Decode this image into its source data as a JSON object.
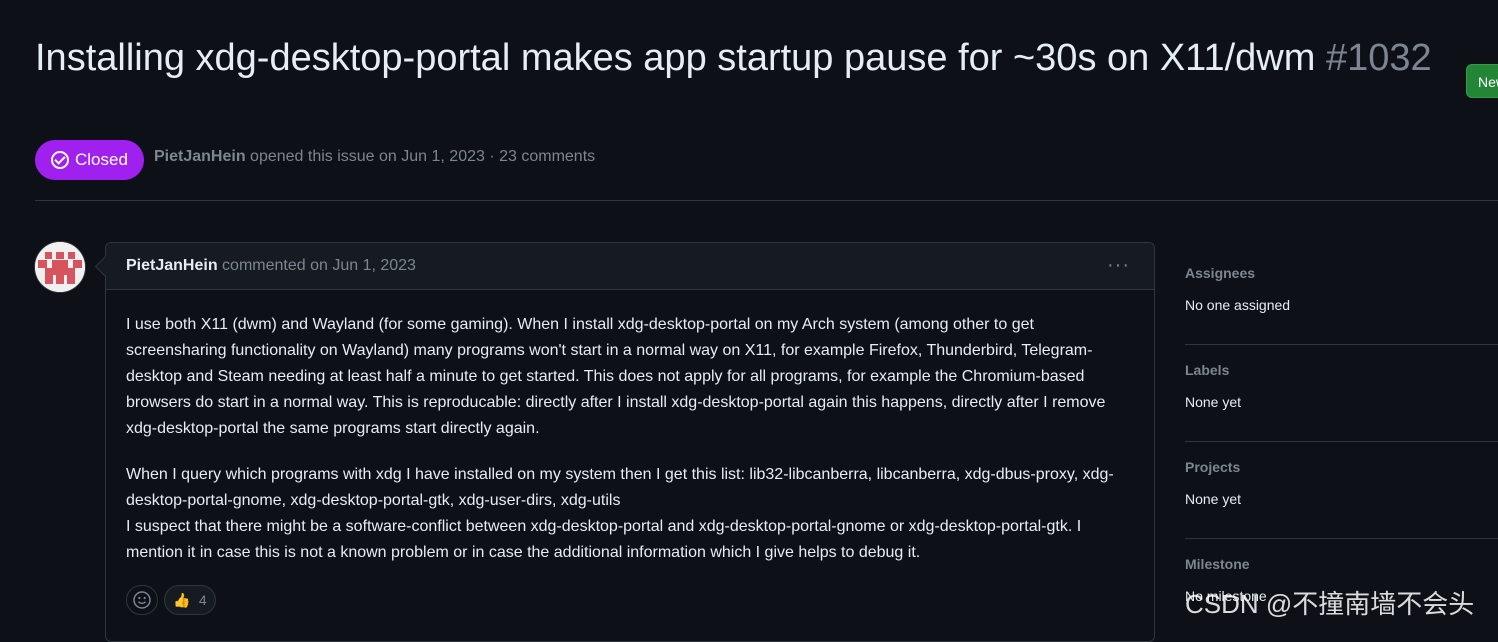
{
  "issue": {
    "title": "Installing xdg-desktop-portal makes app startup pause for ~30s on X11/dwm",
    "number": "#1032",
    "state": "Closed",
    "author": "PietJanHein",
    "opened_text": "opened this issue on Jun 1, 2023 · 23 comments"
  },
  "header": {
    "new_button": "New"
  },
  "comment": {
    "author": "PietJanHein",
    "action": "commented on Jun 1, 2023",
    "menu_icon": "···",
    "paragraph1": "I use both X11 (dwm) and Wayland (for some gaming). When I install xdg-desktop-portal on my Arch system (among other to get screensharing functionality on Wayland) many programs won't start in a normal way on X11, for example Firefox, Thunderbird, Telegram-desktop and Steam needing at least half a minute to get started. This does not apply for all programs, for example the Chromium-based browsers do start in a normal way. This is reproducable: directly after I install xdg-desktop-portal again this happens, directly after I remove xdg-desktop-portal the same programs start directly again.",
    "paragraph2_line1": "When I query which programs with xdg I have installed on my system then I get this list: lib32-libcanberra, libcanberra, xdg-dbus-proxy, xdg-desktop-portal-gnome, xdg-desktop-portal-gtk, xdg-user-dirs, xdg-utils",
    "paragraph2_line2": "I suspect that there might be a software-conflict between xdg-desktop-portal and xdg-desktop-portal-gnome or xdg-desktop-portal-gtk. I mention it in case this is not a known problem or in case the additional information which I give helps to debug it.",
    "reactions": {
      "thumbs_up_emoji": "👍",
      "thumbs_up_count": "4"
    }
  },
  "sidebar": {
    "assignees": {
      "heading": "Assignees",
      "value": "No one assigned"
    },
    "labels": {
      "heading": "Labels",
      "value": "None yet"
    },
    "projects": {
      "heading": "Projects",
      "value": "None yet"
    },
    "milestone": {
      "heading": "Milestone",
      "value": "No milestone"
    }
  },
  "watermark": "CSDN @不撞南墙不会头",
  "colors": {
    "background": "#0d1117",
    "closed_badge": "#a020f0",
    "new_button": "#238636",
    "border": "#30363d",
    "muted_text": "#7d8590"
  }
}
